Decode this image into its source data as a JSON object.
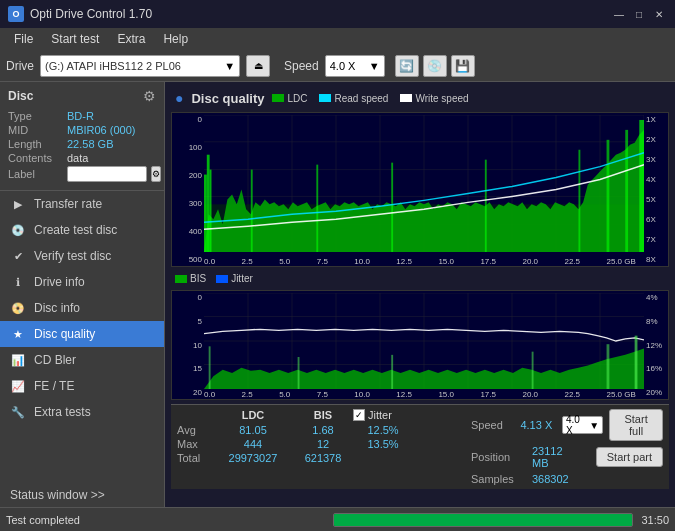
{
  "titlebar": {
    "app_name": "Opti Drive Control 1.70",
    "min_btn": "—",
    "max_btn": "□",
    "close_btn": "✕"
  },
  "menubar": {
    "items": [
      "File",
      "Start test",
      "Extra",
      "Help"
    ]
  },
  "drivebar": {
    "drive_label": "Drive",
    "drive_value": "(G:)  ATAPI iHBS112  2 PL06",
    "speed_label": "Speed",
    "speed_value": "4.0 X"
  },
  "disc": {
    "title": "Disc",
    "type_label": "Type",
    "type_value": "BD-R",
    "mid_label": "MID",
    "mid_value": "MBIR06 (000)",
    "length_label": "Length",
    "length_value": "22.58 GB",
    "contents_label": "Contents",
    "contents_value": "data",
    "label_label": "Label",
    "label_value": ""
  },
  "sidebar": {
    "items": [
      {
        "id": "transfer-rate",
        "label": "Transfer rate",
        "icon": "▶"
      },
      {
        "id": "create-test-disc",
        "label": "Create test disc",
        "icon": "💿"
      },
      {
        "id": "verify-test-disc",
        "label": "Verify test disc",
        "icon": "✔"
      },
      {
        "id": "drive-info",
        "label": "Drive info",
        "icon": "ℹ"
      },
      {
        "id": "disc-info",
        "label": "Disc info",
        "icon": "📀"
      },
      {
        "id": "disc-quality",
        "label": "Disc quality",
        "icon": "★",
        "active": true
      },
      {
        "id": "cd-bler",
        "label": "CD Bler",
        "icon": "📊"
      },
      {
        "id": "fe-te",
        "label": "FE / TE",
        "icon": "📈"
      },
      {
        "id": "extra-tests",
        "label": "Extra tests",
        "icon": "🔧"
      }
    ],
    "status_window": "Status window >>"
  },
  "panel": {
    "title": "Disc quality",
    "legend_top": [
      {
        "color": "#00aa00",
        "label": "LDC"
      },
      {
        "color": "#00ddff",
        "label": "Read speed"
      },
      {
        "color": "#ffffff",
        "label": "Write speed"
      }
    ],
    "legend_bottom": [
      {
        "color": "#00aa00",
        "label": "BIS"
      },
      {
        "color": "#0000ff",
        "label": "Jitter"
      }
    ],
    "chart_top": {
      "y_max": 500,
      "y_labels": [
        "500",
        "400",
        "300",
        "200",
        "100",
        "0"
      ],
      "y_labels_right": [
        "8X",
        "7X",
        "6X",
        "5X",
        "4X",
        "3X",
        "2X",
        "1X"
      ],
      "x_labels": [
        "0.0",
        "2.5",
        "5.0",
        "7.5",
        "10.0",
        "12.5",
        "15.0",
        "17.5",
        "20.0",
        "22.5",
        "25.0 GB"
      ]
    },
    "chart_bottom": {
      "y_max": 20,
      "y_labels": [
        "20",
        "15",
        "10",
        "5",
        "0"
      ],
      "y_labels_right": [
        "20%",
        "16%",
        "12%",
        "8%",
        "4%"
      ],
      "x_labels": [
        "0.0",
        "2.5",
        "5.0",
        "7.5",
        "10.0",
        "12.5",
        "15.0",
        "17.5",
        "20.0",
        "22.5",
        "25.0 GB"
      ]
    }
  },
  "stats": {
    "ldc_header": "LDC",
    "bis_header": "BIS",
    "jitter_header": "Jitter",
    "jitter_checked": true,
    "avg_label": "Avg",
    "avg_ldc": "81.05",
    "avg_bis": "1.68",
    "avg_jitter": "12.5%",
    "max_label": "Max",
    "max_ldc": "444",
    "max_bis": "12",
    "max_jitter": "13.5%",
    "total_label": "Total",
    "total_ldc": "29973027",
    "total_bis": "621378",
    "speed_label": "Speed",
    "speed_value": "4.13 X",
    "speed_select": "4.0 X",
    "position_label": "Position",
    "position_value": "23112 MB",
    "samples_label": "Samples",
    "samples_value": "368302",
    "btn_start_full": "Start full",
    "btn_start_part": "Start part"
  },
  "statusbar": {
    "text": "Test completed",
    "progress": 100,
    "time": "31:50"
  }
}
